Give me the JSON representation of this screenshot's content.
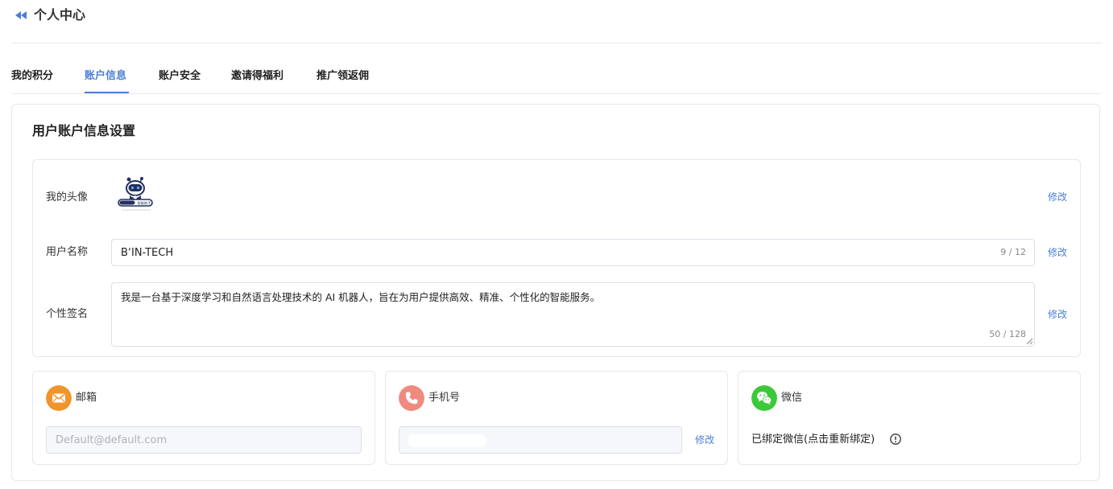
{
  "header": {
    "title": "个人中心"
  },
  "tabs": [
    {
      "label": "我的积分",
      "active": false
    },
    {
      "label": "账户信息",
      "active": true
    },
    {
      "label": "账户安全",
      "active": false
    },
    {
      "label": "邀请得福利",
      "active": false
    },
    {
      "label": "推广领返佣",
      "active": false
    }
  ],
  "settings": {
    "title": "用户账户信息设置",
    "modify_label": "修改",
    "avatar": {
      "label": "我的头像",
      "logo_text": "智能助手"
    },
    "username": {
      "label": "用户名称",
      "value": "B‘IN-TECH",
      "counter": "9 / 12"
    },
    "signature": {
      "label": "个性签名",
      "value": "我是一台基于深度学习和自然语言处理技术的 AI 机器人，旨在为用户提供高效、精准、个性化的智能服务。",
      "counter": "50 / 128"
    }
  },
  "email": {
    "title": "邮箱",
    "placeholder": "Default@default.com",
    "icon": "mail-icon",
    "color": "#f0952d"
  },
  "phone": {
    "title": "手机号",
    "value": "",
    "modify_label": "修改",
    "icon": "phone-icon",
    "color": "#f08a7e"
  },
  "wechat": {
    "title": "微信",
    "status": "已绑定微信(点击重新绑定)",
    "icon": "wechat-icon",
    "color": "#3bc93a"
  },
  "colors": {
    "accent": "#4a7fd4",
    "border": "#e6e7ea"
  }
}
